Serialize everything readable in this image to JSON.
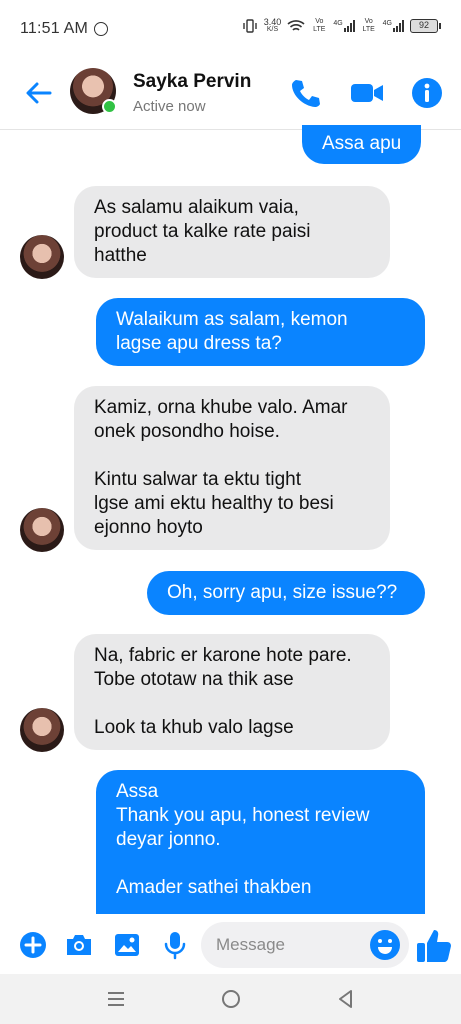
{
  "status_bar": {
    "time": "11:51 AM",
    "net_speed_value": "3.40",
    "net_speed_unit": "K/S",
    "sim1_label": "Vo LTE",
    "sim1_net": "4G",
    "sim2_label": "Vo LTE",
    "sim2_net": "4G",
    "battery": "92"
  },
  "header": {
    "contact_name": "Sayka Pervin",
    "presence": "Active now",
    "accent_color": "#0a84ff"
  },
  "messages": [
    {
      "direction": "out",
      "text": "Assa apu"
    },
    {
      "direction": "in",
      "text": "As salamu alaikum vaia,\nproduct ta kalke rate paisi\nhatthe"
    },
    {
      "direction": "out",
      "text": "Walaikum as salam, kemon\nlagse apu dress ta?"
    },
    {
      "direction": "in",
      "text": "Kamiz, orna khube valo. Amar\nonek posondho hoise.\n\nKintu salwar ta ektu tight\nlgse ami ektu healthy to besi\nejonno hoyto"
    },
    {
      "direction": "out",
      "text": "Oh, sorry apu, size issue??"
    },
    {
      "direction": "in",
      "text": "Na, fabric er karone hote pare.\nTobe ototaw na thik ase\n\nLook ta khub valo lagse"
    },
    {
      "direction": "out",
      "text": "Assa\nThank you apu, honest review\ndeyar jonno.\n\nAmader sathei thakben"
    }
  ],
  "composer": {
    "placeholder": "Message",
    "icons": [
      "plus-icon",
      "camera-icon",
      "gallery-icon",
      "microphone-icon",
      "emoji-icon",
      "thumbs-up-icon"
    ]
  },
  "navbar": {
    "icons": [
      "menu-icon",
      "home-icon",
      "back-triangle-icon"
    ]
  }
}
